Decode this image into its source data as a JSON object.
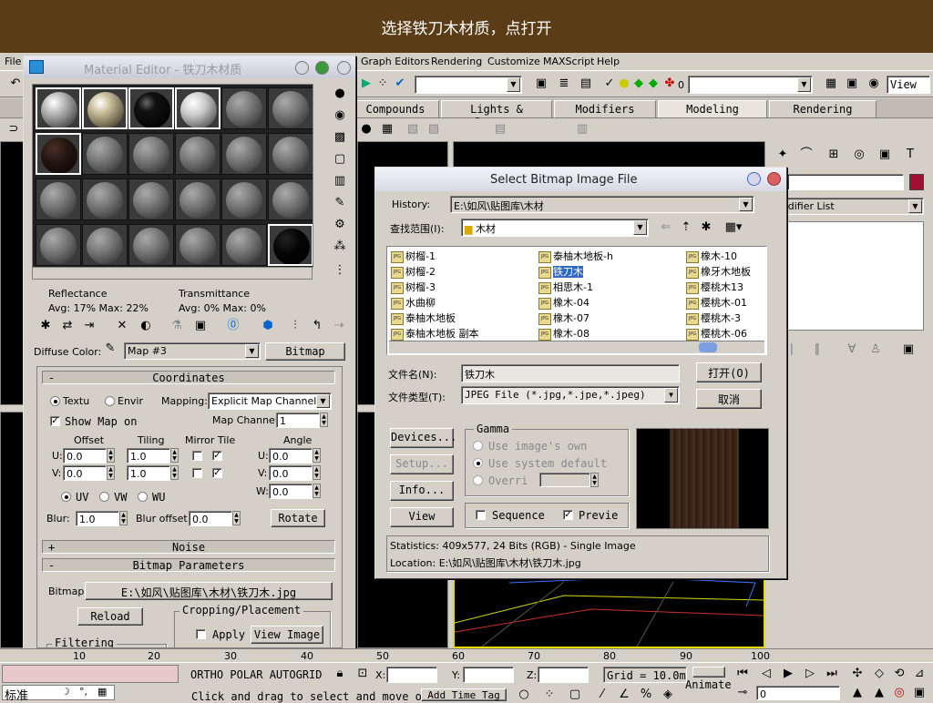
{
  "banner": {
    "text": "选择铁刀木材质，点打开"
  },
  "menubar": {
    "file": "File",
    "graph_editors": "Graph Editors",
    "rendering": "Rendering",
    "customize": "Customize",
    "maxscript": "MAXScript",
    "help": "Help"
  },
  "toolbar": {
    "selection_value": "0",
    "view_value": "View"
  },
  "tabs": [
    "Compounds",
    "Lights & Cameras",
    "Modifiers",
    "Modeling",
    "Rendering"
  ],
  "command_panel": {
    "modifier_list": "odifier List"
  },
  "material_editor": {
    "title": "Material Editor - 铁刀木材质",
    "reflectance_label": "Reflectance",
    "reflectance_value": "Avg:  17% Max:  22%",
    "transmittance_label": "Transmittance",
    "transmittance_value": "Avg:    0% Max:    0%",
    "diffuse_label": "Diffuse Color:",
    "diffuse_map": "Map #3",
    "diffuse_type": "Bitmap",
    "coordinates": {
      "title": "Coordinates",
      "texture_label": "Textu",
      "environ_label": "Envir",
      "mapping_label": "Mapping:",
      "mapping_value": "Explicit Map Channel",
      "show_map_label": "Show Map on",
      "map_channel_label": "Map Channel:",
      "map_channel_value": "1",
      "offset_label": "Offset",
      "tiling_label": "Tiling",
      "mirror_tile_label": "Mirror Tile",
      "angle_label": "Angle",
      "u_label": "U:",
      "v_label": "V:",
      "w_label": "W:",
      "u_offset": "0.0",
      "v_offset": "0.0",
      "u_tiling": "1.0",
      "v_tiling": "1.0",
      "u_angle": "0.0",
      "v_angle": "0.0",
      "w_angle": "0.0",
      "uv_label": "UV",
      "vw_label": "VW",
      "wu_label": "WU",
      "blur_label": "Blur:",
      "blur_value": "1.0",
      "blur_offset_label": "Blur offset:",
      "blur_offset_value": "0.0",
      "rotate_label": "Rotate"
    },
    "noise_title": "Noise",
    "bitmap_params": {
      "title": "Bitmap Parameters",
      "bitmap_label": "Bitmap:",
      "bitmap_path": "E:\\如风\\贴图库\\木材\\铁刀木.jpg",
      "reload_label": "Reload",
      "cropping_label": "Cropping/Placement",
      "apply_label": "Apply",
      "view_image_label": "View Image",
      "filtering_label": "Filtering"
    }
  },
  "bitmap_dialog": {
    "title": "Select Bitmap Image File",
    "history_label": "History:",
    "history_value": "E:\\如风\\贴图库\\木材",
    "lookin_label": "查找范围(I):",
    "lookin_value": "木材",
    "files_col1": [
      "树榴-1",
      "树榴-2",
      "树榴-3",
      "水曲柳",
      "泰柚木地板",
      "泰柚木地板 副本"
    ],
    "files_col2": [
      "泰柚木地板-h",
      "铁刀木",
      "相思木-1",
      "橡木-04",
      "橡木-07",
      "橡木-08"
    ],
    "files_col3": [
      "橡木-10",
      "橡牙木地板",
      "樱桃木13",
      "樱桃木-01",
      "樱桃木-3",
      "樱桃木-06"
    ],
    "selected_file": "铁刀木",
    "filename_label": "文件名(N):",
    "filename_value": "铁刀木",
    "filetype_label": "文件类型(T):",
    "filetype_value": "JPEG File (*.jpg,*.jpe,*.jpeg)",
    "open_label": "打开(O)",
    "cancel_label": "取消",
    "devices_label": "Devices...",
    "setup_label": "Setup...",
    "info_label": "Info...",
    "view_label": "View",
    "gamma_title": "Gamma",
    "use_image_own": "Use image's own",
    "use_system_default": "Use system default",
    "override_label": "Overri",
    "sequence_label": "Sequence",
    "preview_label": "Previe",
    "statistics": "Statistics:  409x577, 24 Bits (RGB) - Single Image",
    "location": "Location:  E:\\如风\\贴图库\\木材\\铁刀木.jpg"
  },
  "ruler": [
    "10",
    "20",
    "30",
    "40",
    "50",
    "60",
    "70",
    "80",
    "90",
    "100"
  ],
  "statusbar": {
    "standard_label": "标准",
    "snaps": "ORTHO  POLAR  AUTOGRID",
    "x_label": "X:",
    "y_label": "Y:",
    "z_label": "Z:",
    "grid": "Grid = 10.0m",
    "prompt": "Click and drag to select and move o",
    "add_time_tag": "Add Time Tag",
    "animate_label": "Animate",
    "frame_value": "0"
  },
  "colors": {
    "banner": "#5a3d16",
    "selection": "#316ac5",
    "viewport_highlight": "#e8d800",
    "wood": "#3a2418"
  }
}
